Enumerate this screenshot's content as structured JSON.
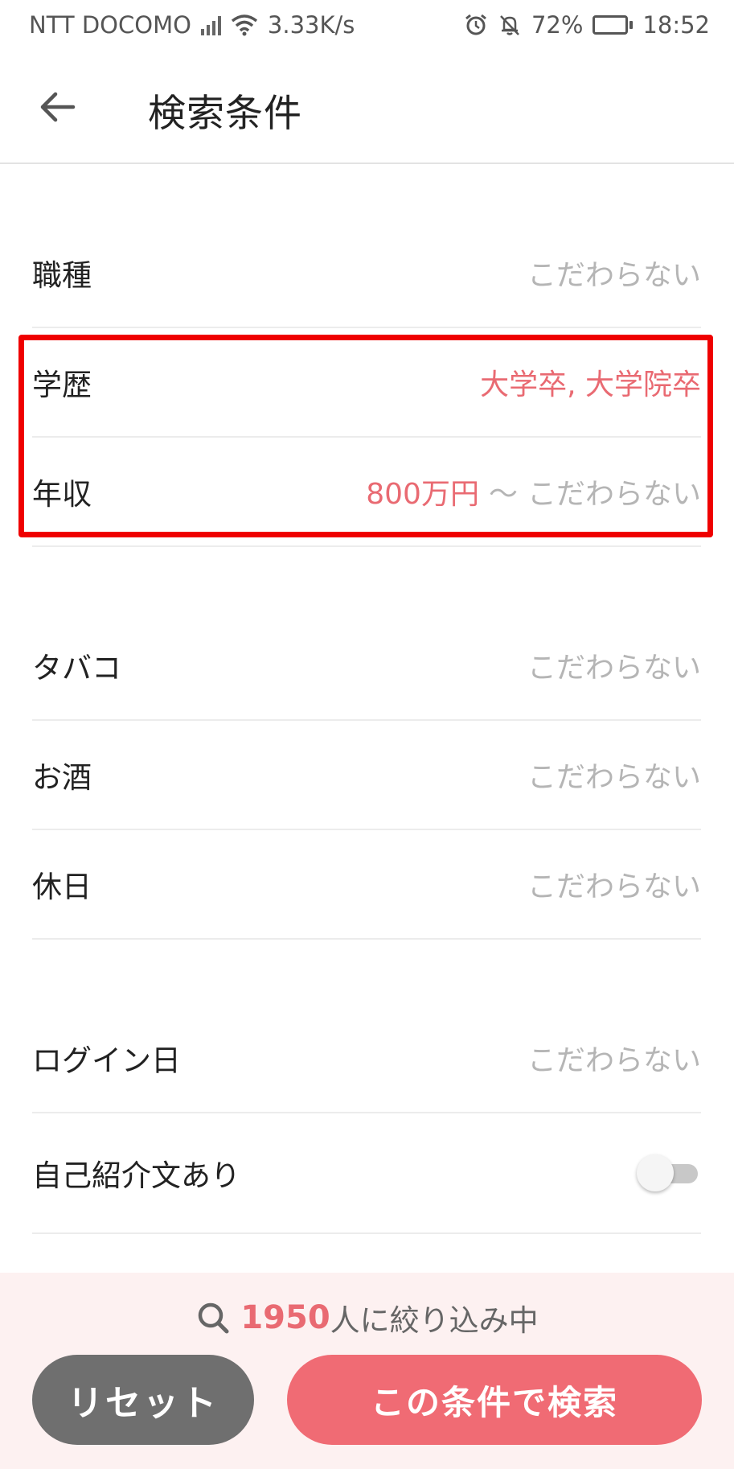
{
  "status_bar": {
    "carrier": "NTT DOCOMO",
    "network_speed": "3.33K/s",
    "battery": "72%",
    "battery_level": 0.72,
    "time": "18:52"
  },
  "header": {
    "back_icon": "arrow-left-icon",
    "title": "検索条件"
  },
  "conditions": {
    "job": {
      "label": "職種",
      "value": "こだわらない"
    },
    "education": {
      "label": "学歴",
      "value": "大学卒, 大学院卒"
    },
    "income": {
      "label": "年収",
      "min": "800万円",
      "separator": "〜",
      "max": "こだわらない"
    },
    "tobacco": {
      "label": "タバコ",
      "value": "こだわらない"
    },
    "alcohol": {
      "label": "お酒",
      "value": "こだわらない"
    },
    "holiday": {
      "label": "休日",
      "value": "こだわらない"
    },
    "login": {
      "label": "ログイン日",
      "value": "こだわらない"
    },
    "self_intro": {
      "label": "自己紹介文あり",
      "toggle_on": false
    }
  },
  "footer": {
    "count": "1950",
    "count_suffix": "人に絞り込み中",
    "reset_label": "リセット",
    "search_label": "この条件で検索"
  },
  "colors": {
    "accent": "#e96a72",
    "button_primary": "#f06b74",
    "button_secondary": "#6f6f6f",
    "highlight": "#ef0000",
    "muted_text": "#b5b5b5"
  }
}
